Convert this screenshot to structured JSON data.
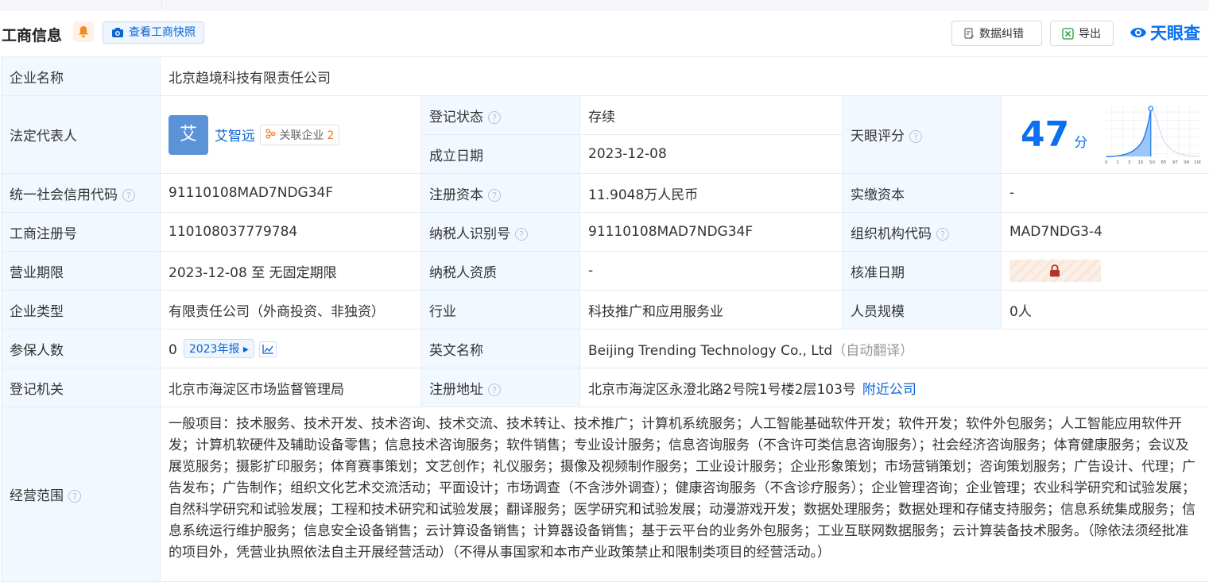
{
  "header": {
    "title": "工商信息",
    "snapshot_label": "查看工商快照",
    "error_label": "数据纠错",
    "export_label": "导出",
    "logo_text": "天眼查"
  },
  "rows": {
    "company_name": {
      "label": "企业名称",
      "value": "北京趋境科技有限责任公司"
    },
    "legal_rep": {
      "label": "法定代表人",
      "avatar": "艾",
      "name": "艾智远",
      "assoc_label": "关联企业",
      "assoc_count": "2"
    },
    "reg_status": {
      "label": "登记状态",
      "value": "存续"
    },
    "founded": {
      "label": "成立日期",
      "value": "2023-12-08"
    },
    "tianyan_score": {
      "label": "天眼评分",
      "value": "47",
      "unit": "分",
      "axis": [
        "0",
        "1",
        "3",
        "15",
        "50",
        "85",
        "97",
        "99",
        "100"
      ]
    },
    "credit_code": {
      "label": "统一社会信用代码",
      "value": "91110108MAD7NDG34F"
    },
    "reg_capital": {
      "label": "注册资本",
      "value": "11.9048万人民币"
    },
    "paid_capital": {
      "label": "实缴资本",
      "value": "-"
    },
    "reg_no": {
      "label": "工商注册号",
      "value": "110108037779784"
    },
    "taxpayer_id": {
      "label": "纳税人识别号",
      "value": "91110108MAD7NDG34F"
    },
    "org_code": {
      "label": "组织机构代码",
      "value": "MAD7NDG3-4"
    },
    "term": {
      "label": "营业期限",
      "value": "2023-12-08 至 无固定期限"
    },
    "tax_qual": {
      "label": "纳税人资质",
      "value": "-"
    },
    "approve_date": {
      "label": "核准日期"
    },
    "company_type": {
      "label": "企业类型",
      "value": "有限责任公司（外商投资、非独资）"
    },
    "industry": {
      "label": "行业",
      "value": "科技推广和应用服务业"
    },
    "staff": {
      "label": "人员规模",
      "value": "0人"
    },
    "insured": {
      "label": "参保人数",
      "value": "0",
      "report": "2023年报"
    },
    "english_name": {
      "label": "英文名称",
      "value": "Beijing Trending Technology Co., Ltd",
      "note": "（自动翻译）"
    },
    "authority": {
      "label": "登记机关",
      "value": "北京市海淀区市场监督管理局"
    },
    "address": {
      "label": "注册地址",
      "value": "北京市海淀区永澄北路2号院1号楼2层103号",
      "link": "附近公司"
    },
    "scope": {
      "label": "经营范围",
      "value": "一般项目：技术服务、技术开发、技术咨询、技术交流、技术转让、技术推广；计算机系统服务；人工智能基础软件开发；软件开发；软件外包服务；人工智能应用软件开发；计算机软硬件及辅助设备零售；信息技术咨询服务；软件销售；专业设计服务；信息咨询服务（不含许可类信息咨询服务）；社会经济咨询服务；体育健康服务；会议及展览服务；摄影扩印服务；体育赛事策划；文艺创作；礼仪服务；摄像及视频制作服务；工业设计服务；企业形象策划；市场营销策划；咨询策划服务；广告设计、代理；广告发布；广告制作；组织文化艺术交流活动；平面设计；市场调查（不含涉外调查）；健康咨询服务（不含诊疗服务）；企业管理咨询；企业管理；农业科学研究和试验发展；自然科学研究和试验发展；工程和技术研究和试验发展；翻译服务；医学研究和试验发展；动漫游戏开发；数据处理服务；数据处理和存储支持服务；信息系统集成服务；信息系统运行维护服务；信息安全设备销售；云计算设备销售；计算器设备销售；基于云平台的业务外包服务；工业互联网数据服务；云计算装备技术服务。（除依法须经批准的项目外，凭营业执照依法自主开展经营活动）（不得从事国家和本市产业政策禁止和限制类项目的经营活动。）"
    }
  }
}
